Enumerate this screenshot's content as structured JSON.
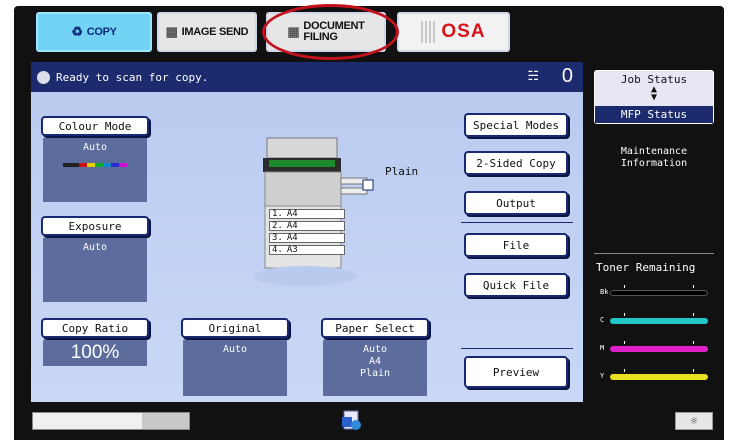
{
  "tabs": {
    "copy": "COPY",
    "image_send": "IMAGE SEND",
    "document_filing_line1": "DOCUMENT",
    "document_filing_line2": "FILING",
    "osa": "OSA"
  },
  "status": {
    "message": "Ready to scan for copy.",
    "copy_count": "0"
  },
  "settings": {
    "colour_mode_label": "Colour Mode",
    "colour_mode_value": "Auto",
    "exposure_label": "Exposure",
    "exposure_value": "Auto",
    "copy_ratio_label": "Copy Ratio",
    "copy_ratio_value": "100%",
    "original_label": "Original",
    "original_value": "Auto",
    "paper_select_label": "Paper Select",
    "paper_select_values": [
      "Auto",
      "A4",
      "Plain"
    ]
  },
  "machine": {
    "paper_type": "Plain",
    "trays": [
      {
        "num": "1.",
        "size": "A4"
      },
      {
        "num": "2.",
        "size": "A4"
      },
      {
        "num": "3.",
        "size": "A4"
      },
      {
        "num": "4.",
        "size": "A3"
      }
    ]
  },
  "actions": {
    "special_modes": "Special Modes",
    "two_sided_copy": "2-Sided Copy",
    "output": "Output",
    "file": "File",
    "quick_file": "Quick File",
    "preview": "Preview"
  },
  "side": {
    "job_status": "Job Status",
    "mfp_status": "MFP Status",
    "maintenance_line1": "Maintenance",
    "maintenance_line2": "Information",
    "toner_remaining": "Toner Remaining",
    "toner": [
      {
        "label": "Bk",
        "color": "#000000"
      },
      {
        "label": "C",
        "color": "#22c6c6"
      },
      {
        "label": "M",
        "color": "#e020c8"
      },
      {
        "label": "Y",
        "color": "#e8e020"
      }
    ]
  },
  "colors": {
    "copy_tab": "#72d3f5",
    "panel_blue": "#b9caf0",
    "header_navy": "#1b2b6e",
    "highlight_circle": "#c3121c"
  }
}
